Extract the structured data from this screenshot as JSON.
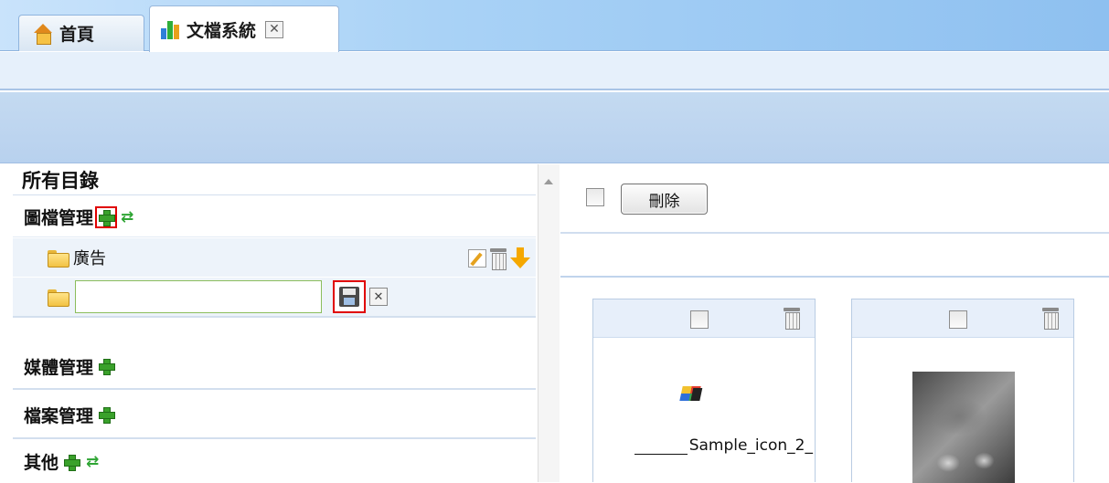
{
  "tabs": [
    {
      "label": "首頁",
      "icon": "home-icon"
    },
    {
      "label": "文檔系統",
      "icon": "chart-icon",
      "closable": true,
      "close_label": "✕"
    }
  ],
  "left": {
    "title": "所有目錄",
    "categories": {
      "image": {
        "label": "圖檔管理"
      },
      "media": {
        "label": "媒體管理"
      },
      "file": {
        "label": "檔案管理"
      },
      "other": {
        "label": "其他"
      }
    },
    "folder_ad": {
      "label": "廣告"
    },
    "new_folder": {
      "value": "",
      "placeholder": ""
    },
    "new_folder_close": "✕",
    "shuffle_glyph": "⇄"
  },
  "right": {
    "delete_button": "刪除",
    "items": [
      {
        "caption_text": "Sample_icon_2_",
        "type": "icon"
      },
      {
        "caption_text": "",
        "type": "photo"
      }
    ]
  },
  "colors": {
    "accent": "#8ec0f0",
    "highlight": "#e00000",
    "add": "#3aa12b"
  }
}
